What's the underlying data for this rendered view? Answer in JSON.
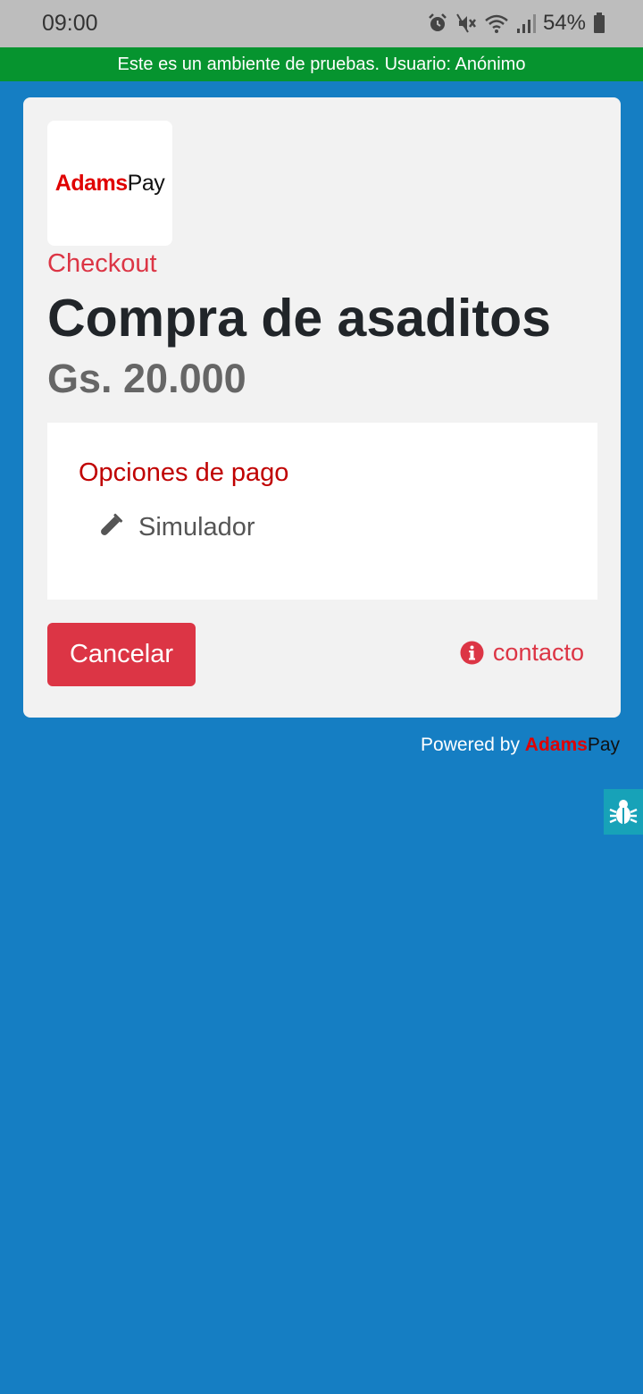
{
  "status_bar": {
    "time": "09:00",
    "battery": "54%",
    "icons": [
      "alarm-icon",
      "mute-icon",
      "wifi-icon",
      "signal-icon",
      "battery-icon"
    ]
  },
  "banner": {
    "text": "Este es un ambiente de pruebas. Usuario: Anónimo"
  },
  "merchant": {
    "logo_primary": "Adams",
    "logo_secondary": "Pay"
  },
  "checkout": {
    "label": "Checkout",
    "title": "Compra de asaditos",
    "price": "Gs. 20.000"
  },
  "payment_options": {
    "title": "Opciones de pago",
    "items": [
      {
        "label": "Simulador",
        "icon": "test-tube-icon"
      }
    ]
  },
  "actions": {
    "cancel_label": "Cancelar",
    "contact_label": "contacto"
  },
  "footer": {
    "powered_prefix": "Powered by ",
    "brand_primary": "Adams",
    "brand_secondary": "Pay"
  },
  "debug": {
    "icon": "bug-icon"
  },
  "colors": {
    "background": "#157ec3",
    "banner": "#06942f",
    "danger": "#dc3545",
    "options_title": "#c00000",
    "debug": "#17a2b8"
  }
}
